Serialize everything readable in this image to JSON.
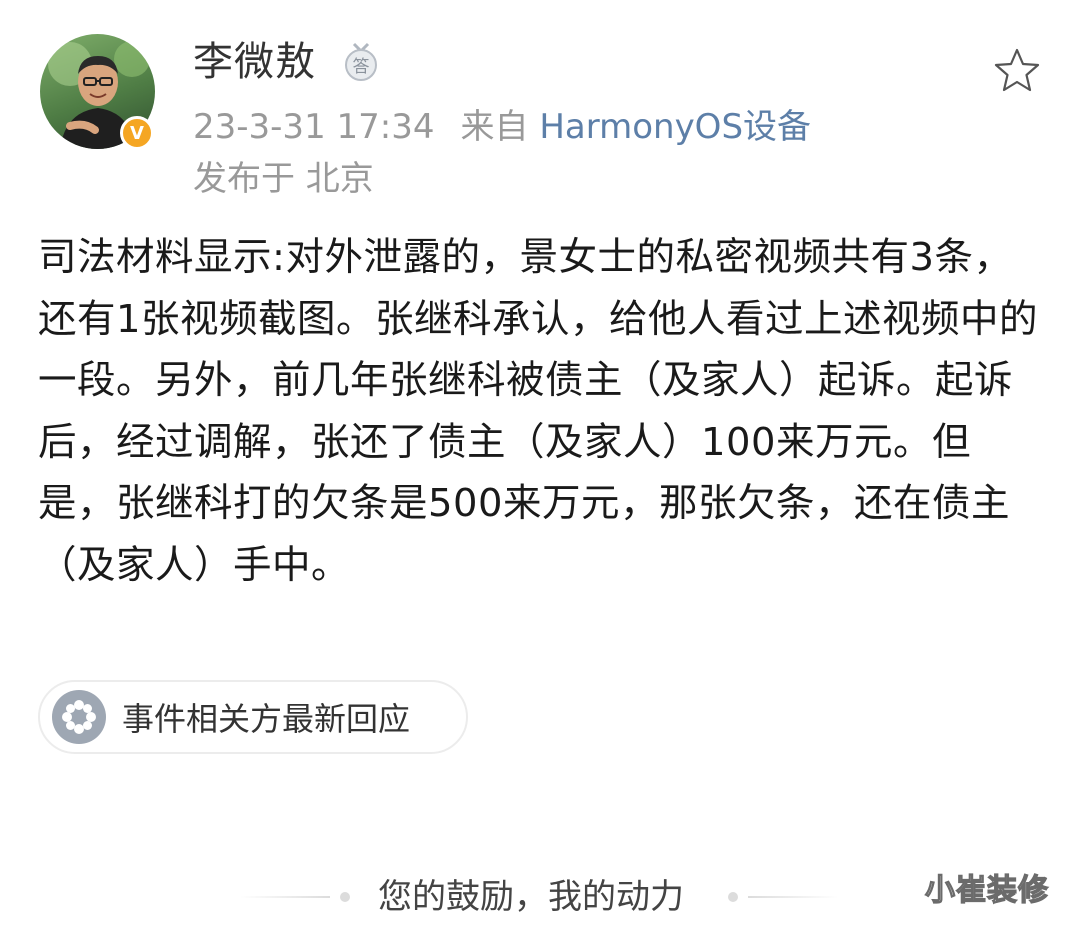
{
  "post": {
    "author": {
      "name": "李微敖",
      "avatar_icon": "avatar-photo",
      "verified_badge": "V",
      "verified_color": "#f5a623",
      "medal_icon": "answer-medal-icon",
      "medal_label": "答"
    },
    "time": "23-3-31 17:34",
    "source_prefix": "来自",
    "source_device": "HarmonyOS设备",
    "location": "发布于 北京",
    "favorite_icon": "star-outline-icon",
    "content": "司法材料显示:对外泄露的，景女士的私密视频共有3条，还有1张视频截图。张继科承认，给他人看过上述视频中的一段。另外，前几年张继科被债主（及家人）起诉。起诉后，经过调解，张还了债主（及家人）100来万元。但是，张继科打的欠条是500来万元，那张欠条，还在债主（及家人）手中。",
    "topic": {
      "icon": "topic-flower-icon",
      "label": "事件相关方最新回应"
    }
  },
  "footer": {
    "text": "您的鼓励，我的动力"
  },
  "watermark": {
    "text": "小崔装修"
  },
  "colors": {
    "link": "#5d7fa8",
    "meta": "#999999",
    "body": "#1a1a1a",
    "badge": "#f5a623",
    "topic_icon_bg": "#9ea7b3"
  }
}
